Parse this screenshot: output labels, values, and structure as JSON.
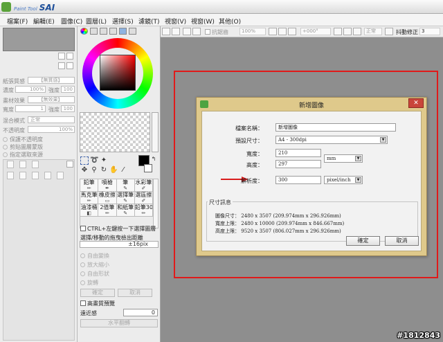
{
  "app": {
    "logo_text": "SAI",
    "logo_prefix": "Paint Tool"
  },
  "menu": [
    "檔案(F)",
    "編輯(E)",
    "圖像(C)",
    "圖層(L)",
    "選擇(S)",
    "濾鏡(T)",
    "視窗(V)",
    "視窗(W)",
    "其他(O)"
  ],
  "left_panel": {
    "rows": [
      {
        "label": "紙張質感",
        "value": "【無質感】"
      },
      {
        "label": "濃度",
        "value": "100%"
      },
      {
        "label": "強度",
        "value": "100"
      },
      {
        "label": "畫材效果",
        "value": "【無效果】"
      },
      {
        "label": "寬度",
        "value": "1"
      },
      {
        "label": "強度",
        "value": "100"
      },
      {
        "label": "混合模式",
        "value": "正常"
      },
      {
        "label": "不透明度",
        "value": "100%"
      }
    ],
    "checks": [
      "保護不透明度",
      "剪貼圖層蒙版",
      "指定選取來源"
    ]
  },
  "tool_panel": {
    "brushes": [
      "鉛筆",
      "噴槍",
      "筆",
      "水彩筆",
      "馬克筆",
      "橡皮擦",
      "選擇筆",
      "選區擦",
      "油漆桶",
      "2值筆",
      "和紙筆",
      "鉛筆30"
    ],
    "ctrl_label": "CTRL+左鍵按一下選擇圖層",
    "drag_label": "選擇/移動的拖曳檢出距離",
    "drag_value": "±16pix",
    "radios": [
      "自由變換",
      "放大縮小",
      "自由形狀",
      "旋轉"
    ],
    "confirm_label": "確定",
    "cancel_label": "取消",
    "hq_preview": "高畫質預覽",
    "distance_label": "遠近感",
    "distance_value": "0",
    "flip_label": "水平翻轉"
  },
  "canvas_toolbar": {
    "antialias": "抗鋸齒",
    "zoom": "100%",
    "angle": "+000°",
    "blend": "正常",
    "stabilizer_label": "抖動修正",
    "stabilizer_value": "3"
  },
  "dialog": {
    "title": "新增圖像",
    "name_label": "檔案名稱：",
    "name_value": "新增圖像",
    "preset_label": "預設尺寸：",
    "preset_value": "A4 - 300dpi",
    "width_label": "寬度：",
    "width_value": "210",
    "height_label": "高度：",
    "height_value": "297",
    "unit_value": "mm",
    "resolution_label": "解析度：",
    "resolution_value": "300",
    "resolution_unit": "pixel/inch",
    "info_title": "尺寸訊息",
    "info": [
      {
        "k": "圖像尺寸：",
        "v": "2480 x 3507 (209.974mm x 296.926mm)"
      },
      {
        "k": "寬度上限：",
        "v": "2480 x 10000 (209.974mm x 846.667mm)"
      },
      {
        "k": "高度上限：",
        "v": "9520 x 3507 (806.027mm x 296.926mm)"
      }
    ],
    "ok_label": "確定",
    "cancel_label": "取消",
    "close_glyph": "✕"
  },
  "watermark": "#1812843",
  "colors": {
    "highlight_frame": "#e01a1a",
    "dialog_frame": "#dfc98b",
    "canvas_bg": "#8e8e8e"
  }
}
